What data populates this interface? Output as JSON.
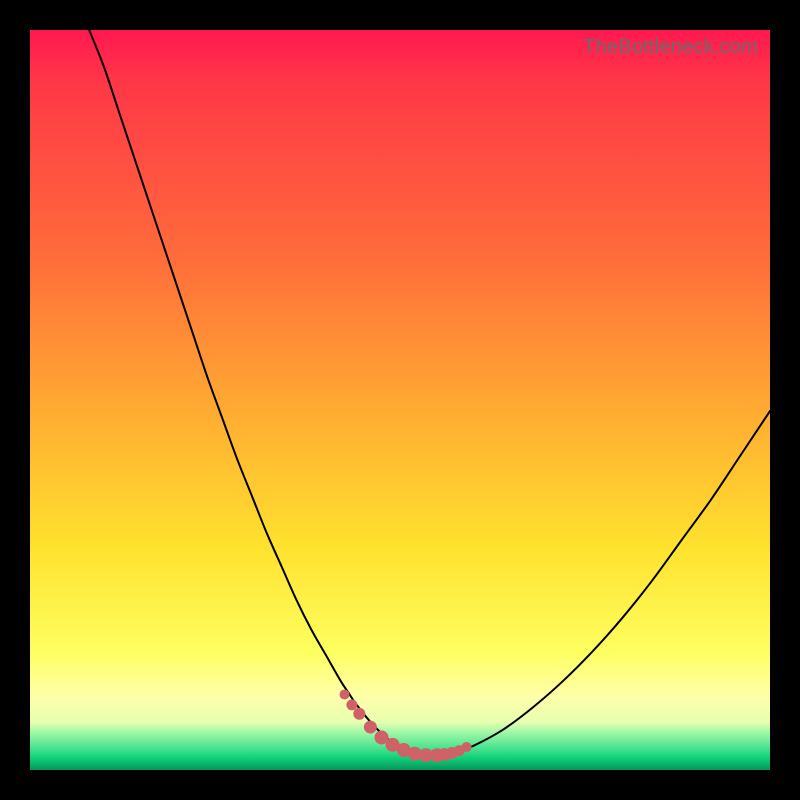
{
  "watermark": "TheBottleneck.com",
  "colors": {
    "background": "#000000",
    "gradient_top": "#ff1850",
    "gradient_mid": "#ffe22e",
    "gradient_bottom": "#039857",
    "curve": "#000000",
    "markers": "#cf6266"
  },
  "chart_data": {
    "type": "line",
    "title": "",
    "xlabel": "",
    "ylabel": "",
    "xlim": [
      0,
      100
    ],
    "ylim": [
      0,
      100
    ],
    "grid": false,
    "series": [
      {
        "name": "bottleneck-curve",
        "x": [
          8,
          10,
          12,
          14,
          16,
          18,
          20,
          22,
          24,
          26,
          28,
          30,
          32,
          34,
          36,
          38,
          40,
          42,
          43,
          44,
          46,
          48,
          50,
          52,
          53,
          54,
          56,
          58,
          60,
          64,
          68,
          72,
          76,
          80,
          84,
          88,
          92,
          96,
          100
        ],
        "y": [
          100,
          95,
          89,
          83,
          77,
          71,
          65,
          59,
          53,
          47.5,
          42,
          37,
          32,
          27.5,
          23,
          19,
          15.5,
          12,
          10.5,
          9,
          6.5,
          4.5,
          3,
          2.3,
          2.1,
          2.1,
          2.2,
          2.6,
          3.3,
          5.5,
          8.5,
          12,
          16,
          20.5,
          25.5,
          31,
          36.5,
          42.5,
          48.5
        ]
      }
    ],
    "markers": {
      "name": "highlight-dots",
      "x": [
        42.5,
        43.5,
        44.5,
        46,
        47.5,
        49,
        50.5,
        52,
        53.5,
        55,
        56,
        57,
        58,
        59
      ],
      "y": [
        10.2,
        8.8,
        7.6,
        5.8,
        4.4,
        3.4,
        2.7,
        2.2,
        2.0,
        2.0,
        2.1,
        2.3,
        2.6,
        3.1
      ],
      "r": [
        5,
        5.5,
        6,
        6.5,
        7,
        7,
        7,
        7,
        7,
        7,
        6.5,
        6,
        5.5,
        5
      ]
    }
  }
}
